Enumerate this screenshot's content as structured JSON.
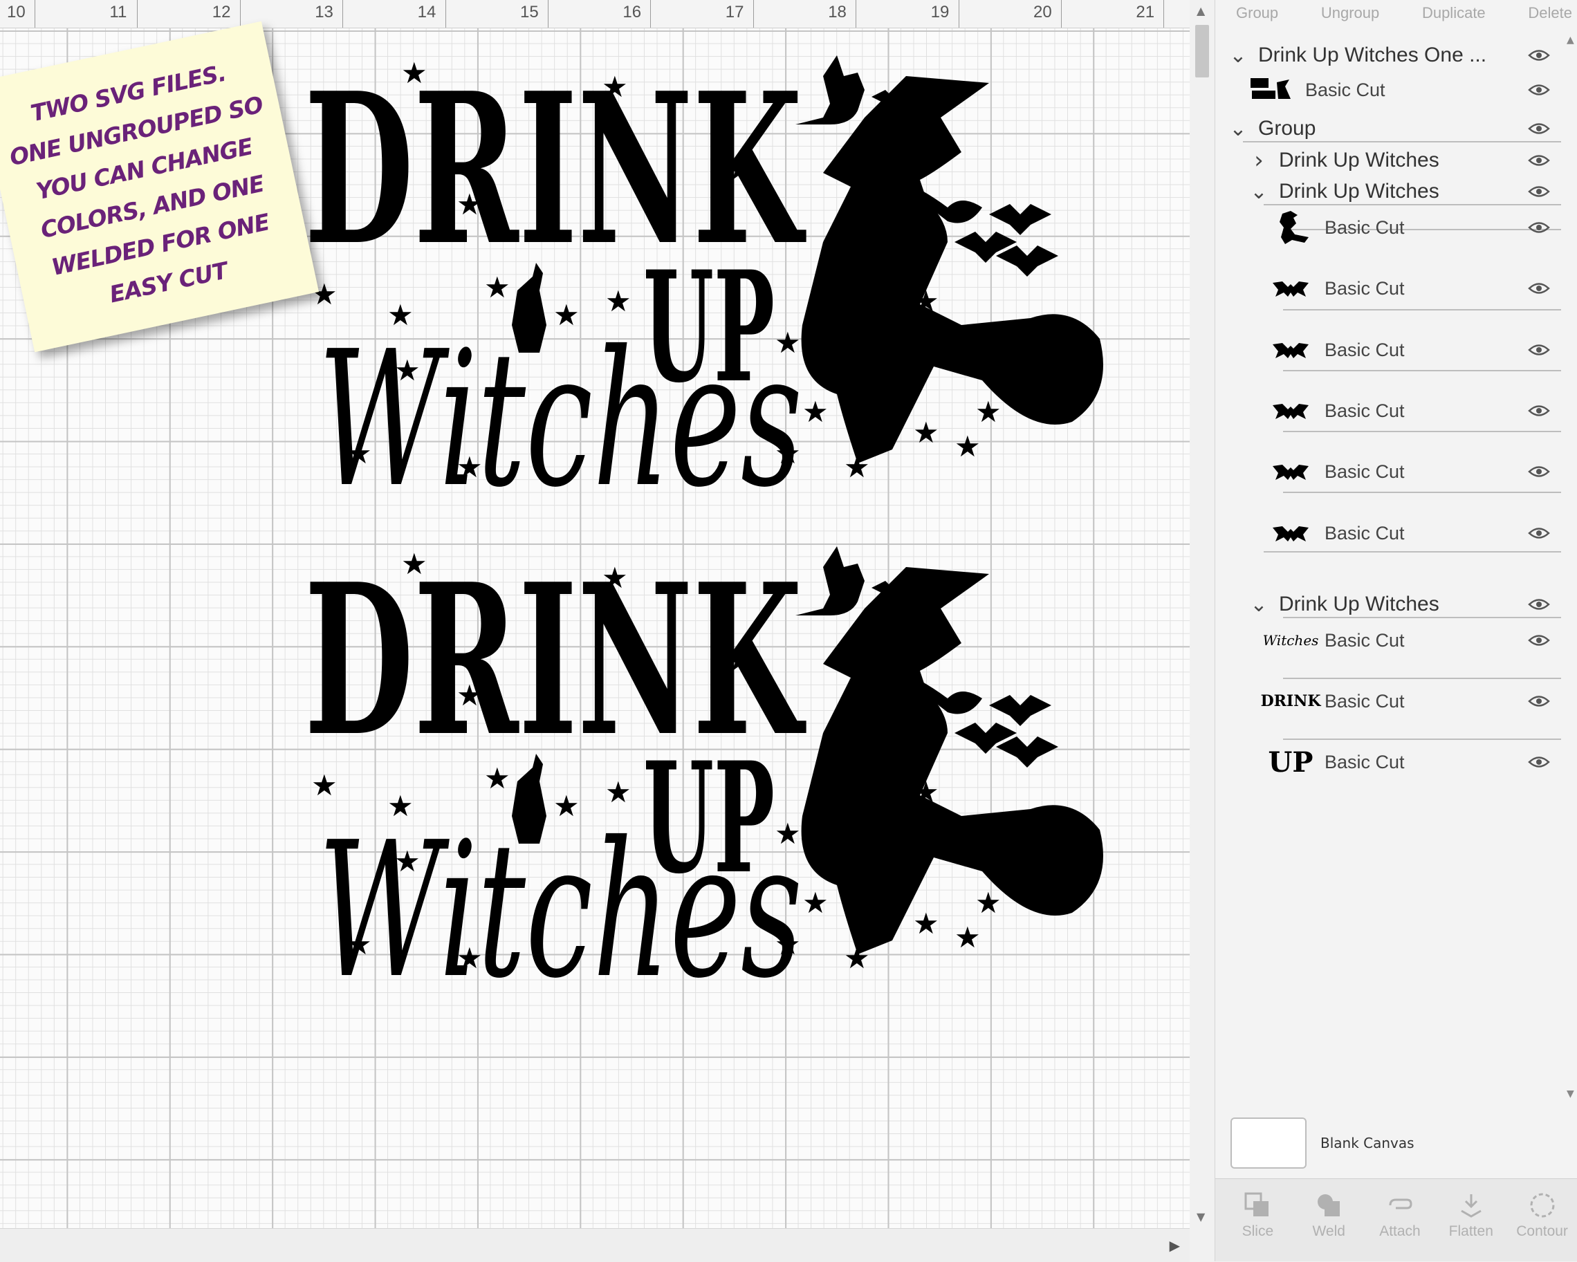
{
  "ruler": {
    "labels": [
      "10",
      "11",
      "12",
      "13",
      "14",
      "15",
      "16",
      "17",
      "18",
      "19",
      "20",
      "21"
    ]
  },
  "sticky_note": {
    "lines": [
      "TWO SVG FILES.",
      "ONE UNGROUPED SO",
      "YOU CAN CHANGE",
      "COLORS, AND ONE",
      "WELDED FOR ONE",
      "EASY CUT"
    ],
    "text_color": "#6a2279",
    "background": "#fdfbd8"
  },
  "design": {
    "word_drink": "DRINK",
    "word_up": "UP",
    "word_witches": "Witches"
  },
  "panel": {
    "toolbar": {
      "group": "Group",
      "ungroup": "Ungroup",
      "duplicate": "Duplicate",
      "delete": "Delete"
    },
    "layers": [
      {
        "label": "Drink Up Witches One ...",
        "chevron": "v"
      },
      {
        "label": "Basic Cut",
        "thumb": "combined-thumbnail"
      },
      {
        "label": "Group",
        "chevron": "v"
      },
      {
        "label": "Drink Up Witches",
        "chevron": ">"
      },
      {
        "label": "Drink Up Witches",
        "chevron": "v"
      },
      {
        "label": "Basic Cut",
        "thumb": "witch-thumbnail"
      },
      {
        "label": "Basic Cut",
        "thumb": "bat-thumbnail"
      },
      {
        "label": "Basic Cut",
        "thumb": "bat-thumbnail"
      },
      {
        "label": "Basic Cut",
        "thumb": "bat-thumbnail"
      },
      {
        "label": "Basic Cut",
        "thumb": "bat-thumbnail"
      },
      {
        "label": "Basic Cut",
        "thumb": "bat-thumbnail"
      },
      {
        "label": "Drink Up Witches",
        "chevron": "v"
      },
      {
        "label": "Basic Cut",
        "thumb": "witches-text-thumbnail",
        "thumb_text": "Witches"
      },
      {
        "label": "Basic Cut",
        "thumb": "drink-text-thumbnail",
        "thumb_text": "DRINK"
      },
      {
        "label": "Basic Cut",
        "thumb": "up-text-thumbnail",
        "thumb_text": "UP"
      }
    ],
    "blank_canvas": "Blank Canvas",
    "tools": [
      "Slice",
      "Weld",
      "Attach",
      "Flatten",
      "Contour"
    ]
  },
  "colors": {
    "ink": "#000000",
    "disabled": "#b1b1b1",
    "canvas": "#fbfbfb"
  }
}
